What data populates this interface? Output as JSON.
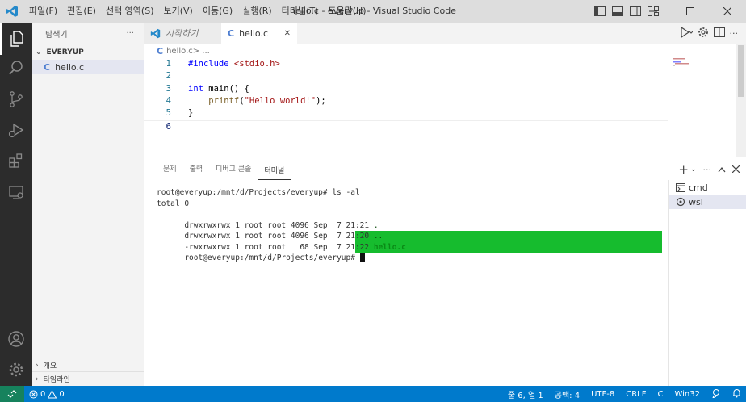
{
  "window": {
    "title": "hello.c - everyup - Visual Studio Code",
    "menu": [
      "파일(F)",
      "편집(E)",
      "선택 영역(S)",
      "보기(V)",
      "이동(G)",
      "실행(R)",
      "터미널(T)",
      "도움말(H)"
    ]
  },
  "sidebar": {
    "title": "탐색기",
    "more": "···",
    "folder": "EVERYUP",
    "file_icon": "C",
    "file": "hello.c",
    "outline": "개요",
    "timeline": "타임라인"
  },
  "editor": {
    "tab_welcome": "시작하기",
    "tab_active_icon": "C",
    "tab_active": "hello.c",
    "tab_close": "✕",
    "breadcrumb_icon": "C",
    "breadcrumb_file": "hello.c",
    "breadcrumb_sep": " > ...",
    "lines": [
      {
        "num": "1",
        "tokens": [
          {
            "t": "#include ",
            "c": "pp"
          },
          {
            "t": "<stdio.h>",
            "c": "inc"
          }
        ]
      },
      {
        "num": "2",
        "tokens": []
      },
      {
        "num": "3",
        "tokens": [
          {
            "t": "int",
            "c": "kw"
          },
          {
            "t": " main() {",
            "c": ""
          }
        ]
      },
      {
        "num": "4",
        "tokens": [
          {
            "t": "    ",
            "c": ""
          },
          {
            "t": "printf",
            "c": "fn"
          },
          {
            "t": "(",
            "c": ""
          },
          {
            "t": "\"Hello world!\"",
            "c": "str"
          },
          {
            "t": ");",
            "c": ""
          }
        ]
      },
      {
        "num": "5",
        "tokens": [
          {
            "t": "}",
            "c": ""
          }
        ]
      },
      {
        "num": "6",
        "tokens": []
      }
    ]
  },
  "panel": {
    "tabs": [
      "문제",
      "출력",
      "디버그 콘솔",
      "터미널"
    ],
    "add": "+",
    "terminal_lines": [
      "root@everyup:/mnt/d/Projects/everyup# ls -al",
      "total 0",
      "drwxrwxrwx 1 root root 4096 Sep  7 21:21 ",
      "drwxrwxrwx 1 root root 4096 Sep  7 21:20 ",
      "-rwxrwxrwx 1 root root   68 Sep  7 21:22 ",
      "root@everyup:/mnt/d/Projects/everyup# "
    ],
    "dir_names": [
      ".",
      ".."
    ],
    "file_name": "hello.c",
    "terminals": [
      "cmd",
      "wsl"
    ]
  },
  "status": {
    "errors": "0",
    "warnings": "0",
    "position": "줄 6, 열 1",
    "spaces": "공백: 4",
    "encoding": "UTF-8",
    "eol": "CRLF",
    "language": "C",
    "platform": "Win32"
  },
  "colors": {
    "status_bar": "#007acc",
    "remote": "#16825d",
    "activity_bar": "#2c2c2c",
    "terminal_highlight": "#16bc2e"
  }
}
